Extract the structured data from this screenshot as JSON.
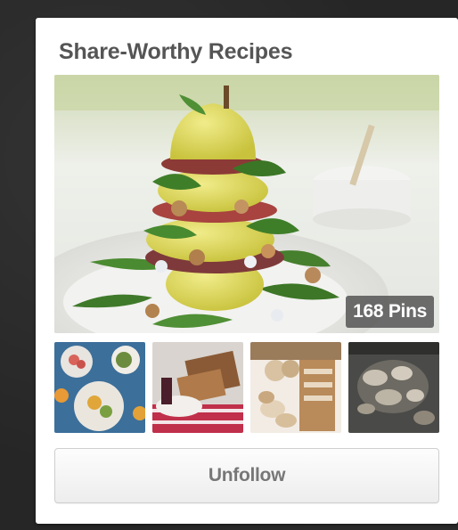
{
  "board": {
    "title": "Share-Worthy Recipes",
    "pin_count_label": "168 Pins",
    "unfollow_label": "Unfollow",
    "thumbnails": [
      {
        "icon": "fruit-platter-thumbnail"
      },
      {
        "icon": "bread-slices-thumbnail"
      },
      {
        "icon": "baguette-loaves-thumbnail"
      },
      {
        "icon": "roasted-dish-thumbnail"
      }
    ]
  },
  "colors": {
    "title_text": "#555555",
    "button_text": "#777777",
    "badge_bg": "#555555",
    "card_bg": "#ffffff",
    "page_bg": "#262626"
  }
}
